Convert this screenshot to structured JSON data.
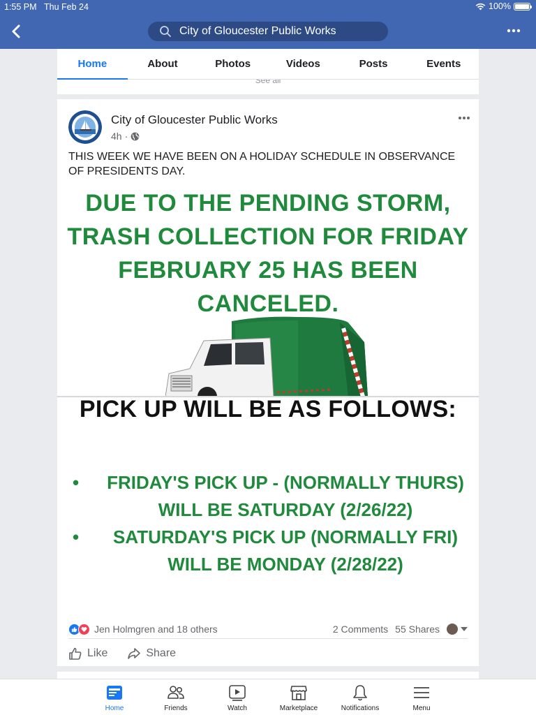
{
  "status_bar": {
    "time": "1:55 PM",
    "date": "Thu Feb 24",
    "battery": "100%"
  },
  "header": {
    "search_text": "City of Gloucester Public Works"
  },
  "page_tabs": [
    {
      "label": "Home",
      "active": true
    },
    {
      "label": "About",
      "active": false
    },
    {
      "label": "Photos",
      "active": false
    },
    {
      "label": "Videos",
      "active": false
    },
    {
      "label": "Posts",
      "active": false
    },
    {
      "label": "Events",
      "active": false
    }
  ],
  "see_all": "See all",
  "post": {
    "author": "City of Gloucester Public Works",
    "time": "4h",
    "text": "THIS WEEK WE HAVE BEEN ON A HOLIDAY SCHEDULE IN OBSERVANCE OF PRESIDENTS DAY.",
    "image": {
      "headline_lines": [
        "DUE TO THE PENDING STORM,",
        "TRASH COLLECTION FOR FRIDAY",
        "FEBRUARY 25 HAS BEEN",
        "CANCELED."
      ],
      "pickup_title": "PICK UP WILL BE AS FOLLOWS:",
      "items": [
        {
          "line1": "FRIDAY'S PICK UP - (NORMALLY THURS)",
          "line2": "WILL BE SATURDAY (2/26/22)"
        },
        {
          "line1": "SATURDAY'S PICK UP (NORMALLY FRI)",
          "line2": "WILL BE MONDAY (2/28/22)"
        }
      ]
    },
    "reactions_text": "Jen Holmgren and 18 others",
    "comments": "2 Comments",
    "shares": "55 Shares",
    "like_label": "Like",
    "share_label": "Share"
  },
  "bottom_nav": [
    {
      "label": "Home",
      "icon": "home-icon",
      "active": true
    },
    {
      "label": "Friends",
      "icon": "friends-icon",
      "active": false
    },
    {
      "label": "Watch",
      "icon": "watch-icon",
      "active": false
    },
    {
      "label": "Marketplace",
      "icon": "marketplace-icon",
      "active": false
    },
    {
      "label": "Notifications",
      "icon": "bell-icon",
      "active": false
    },
    {
      "label": "Menu",
      "icon": "menu-icon",
      "active": false
    }
  ],
  "colors": {
    "header_blue": "#4267b2",
    "accent": "#1877f2",
    "notice_green": "#1f8a3b"
  }
}
